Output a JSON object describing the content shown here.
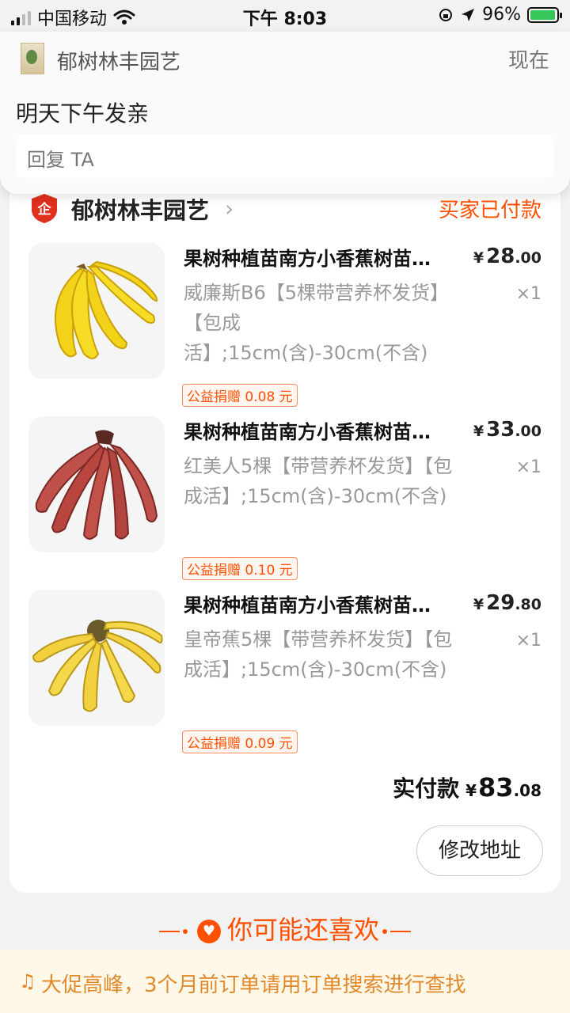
{
  "status_bar": {
    "carrier": "中国移动",
    "time": "下午 8:03",
    "battery": "96%",
    "battery_level": 0.96
  },
  "notification": {
    "app_name": "郁树林丰园艺",
    "time": "现在",
    "message": "明天下午发亲",
    "reply_placeholder": "回复 TA"
  },
  "order": {
    "shop_name": "郁树林丰园艺",
    "status": "买家已付款",
    "items": [
      {
        "title": "果树种植苗南方小香蕉树苗…",
        "sku": "威廉斯B6【5棵带营养杯发货】【包成活】;15cm(含)-30cm(不含)",
        "price_symbol": "¥",
        "price_int": "28",
        "price_dec": ".00",
        "qty": "×1",
        "donation": "公益捐赠 0.08 元",
        "image": "yellow-banana-bunch"
      },
      {
        "title": "果树种植苗南方小香蕉树苗…",
        "sku": "红美人5棵【带营养杯发货】【包成活】;15cm(含)-30cm(不含)",
        "price_symbol": "¥",
        "price_int": "33",
        "price_dec": ".00",
        "qty": "×1",
        "donation": "公益捐赠 0.10 元",
        "image": "red-banana-bunch"
      },
      {
        "title": "果树种植苗南方小香蕉树苗…",
        "sku": "皇帝蕉5棵【带营养杯发货】【包成活】;15cm(含)-30cm(不含)",
        "price_symbol": "¥",
        "price_int": "29",
        "price_dec": ".80",
        "qty": "×1",
        "donation": "公益捐赠 0.09 元",
        "image": "emperor-banana-bunch"
      }
    ],
    "total_label": "实付款",
    "total_symbol": "¥",
    "total_int": "83",
    "total_dec": ".08",
    "change_address_label": "修改地址"
  },
  "recommendation": {
    "title": "你可能还喜欢"
  },
  "tip": {
    "text": "大促高峰，3个月前订单请用订单搜索进行查找"
  },
  "colors": {
    "accent": "#ff5000",
    "tip_text": "#e08a2b",
    "tip_bg": "#fff7e8"
  }
}
